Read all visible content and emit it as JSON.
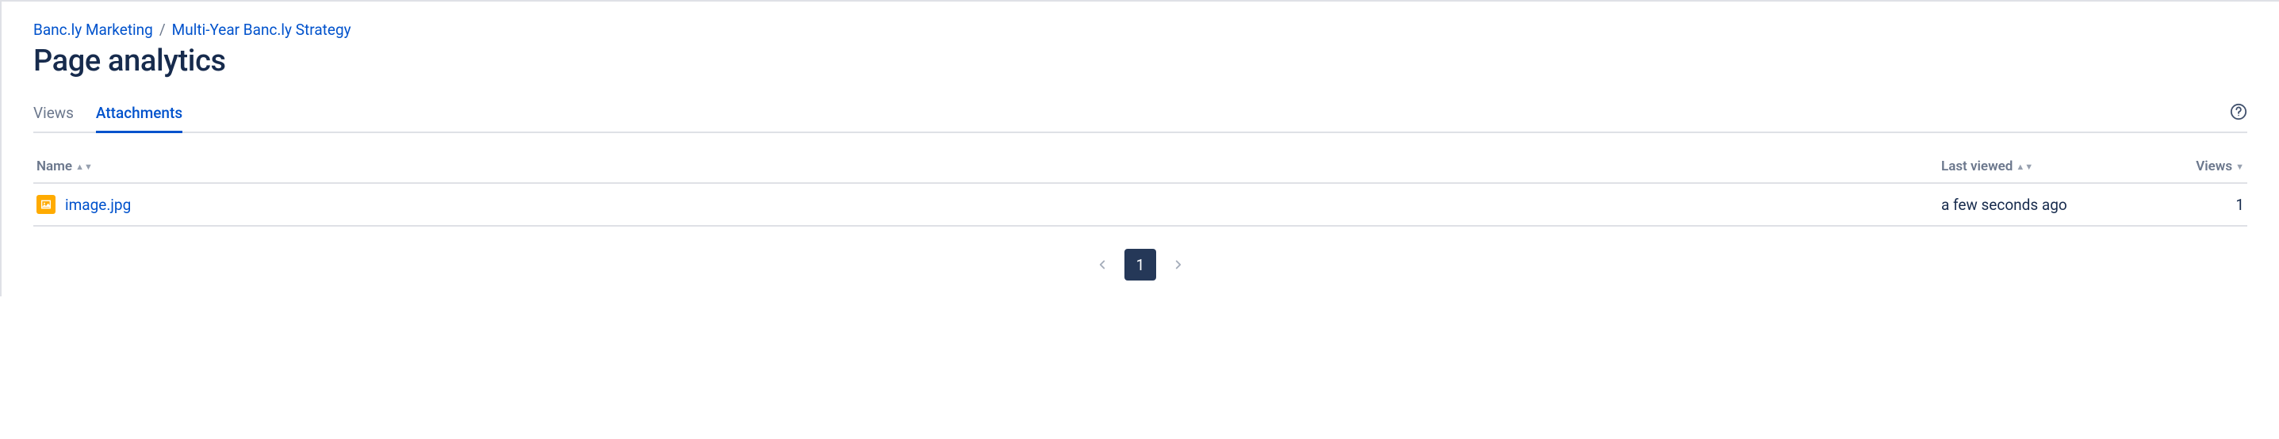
{
  "breadcrumb": {
    "items": [
      "Banc.ly Marketing",
      "Multi-Year Banc.ly Strategy"
    ],
    "separator": "/"
  },
  "page_title": "Page analytics",
  "tabs": {
    "views": "Views",
    "attachments": "Attachments",
    "active": "attachments"
  },
  "table": {
    "headers": {
      "name": "Name",
      "last_viewed": "Last viewed",
      "views": "Views"
    },
    "rows": [
      {
        "filename": "image.jpg",
        "last_viewed": "a few seconds ago",
        "views": "1"
      }
    ]
  },
  "pagination": {
    "pages": [
      "1"
    ],
    "current": "1"
  }
}
